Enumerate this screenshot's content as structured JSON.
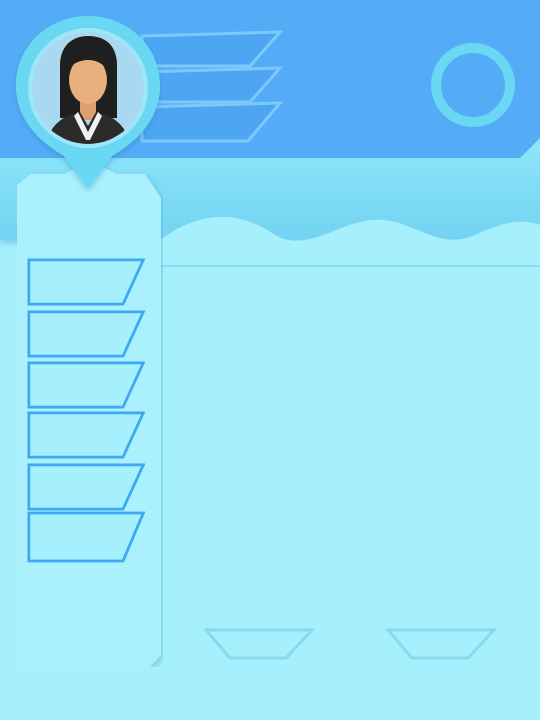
{
  "colors": {
    "header_blue": "#55acf6",
    "band_blue": "#7ddcf6",
    "panel_cyan": "#a6effd",
    "accent_blue": "#3fa8f2",
    "ring_cyan": "#6ad8f3"
  },
  "avatar": {
    "icon": "female-businessperson-avatar"
  },
  "header_tabs": [
    {},
    {},
    {}
  ],
  "sidebar_tabs": [
    {},
    {},
    {},
    {},
    {},
    {}
  ],
  "bottom_tabs": [
    {},
    {}
  ],
  "settings": {
    "icon": "ring-icon"
  }
}
